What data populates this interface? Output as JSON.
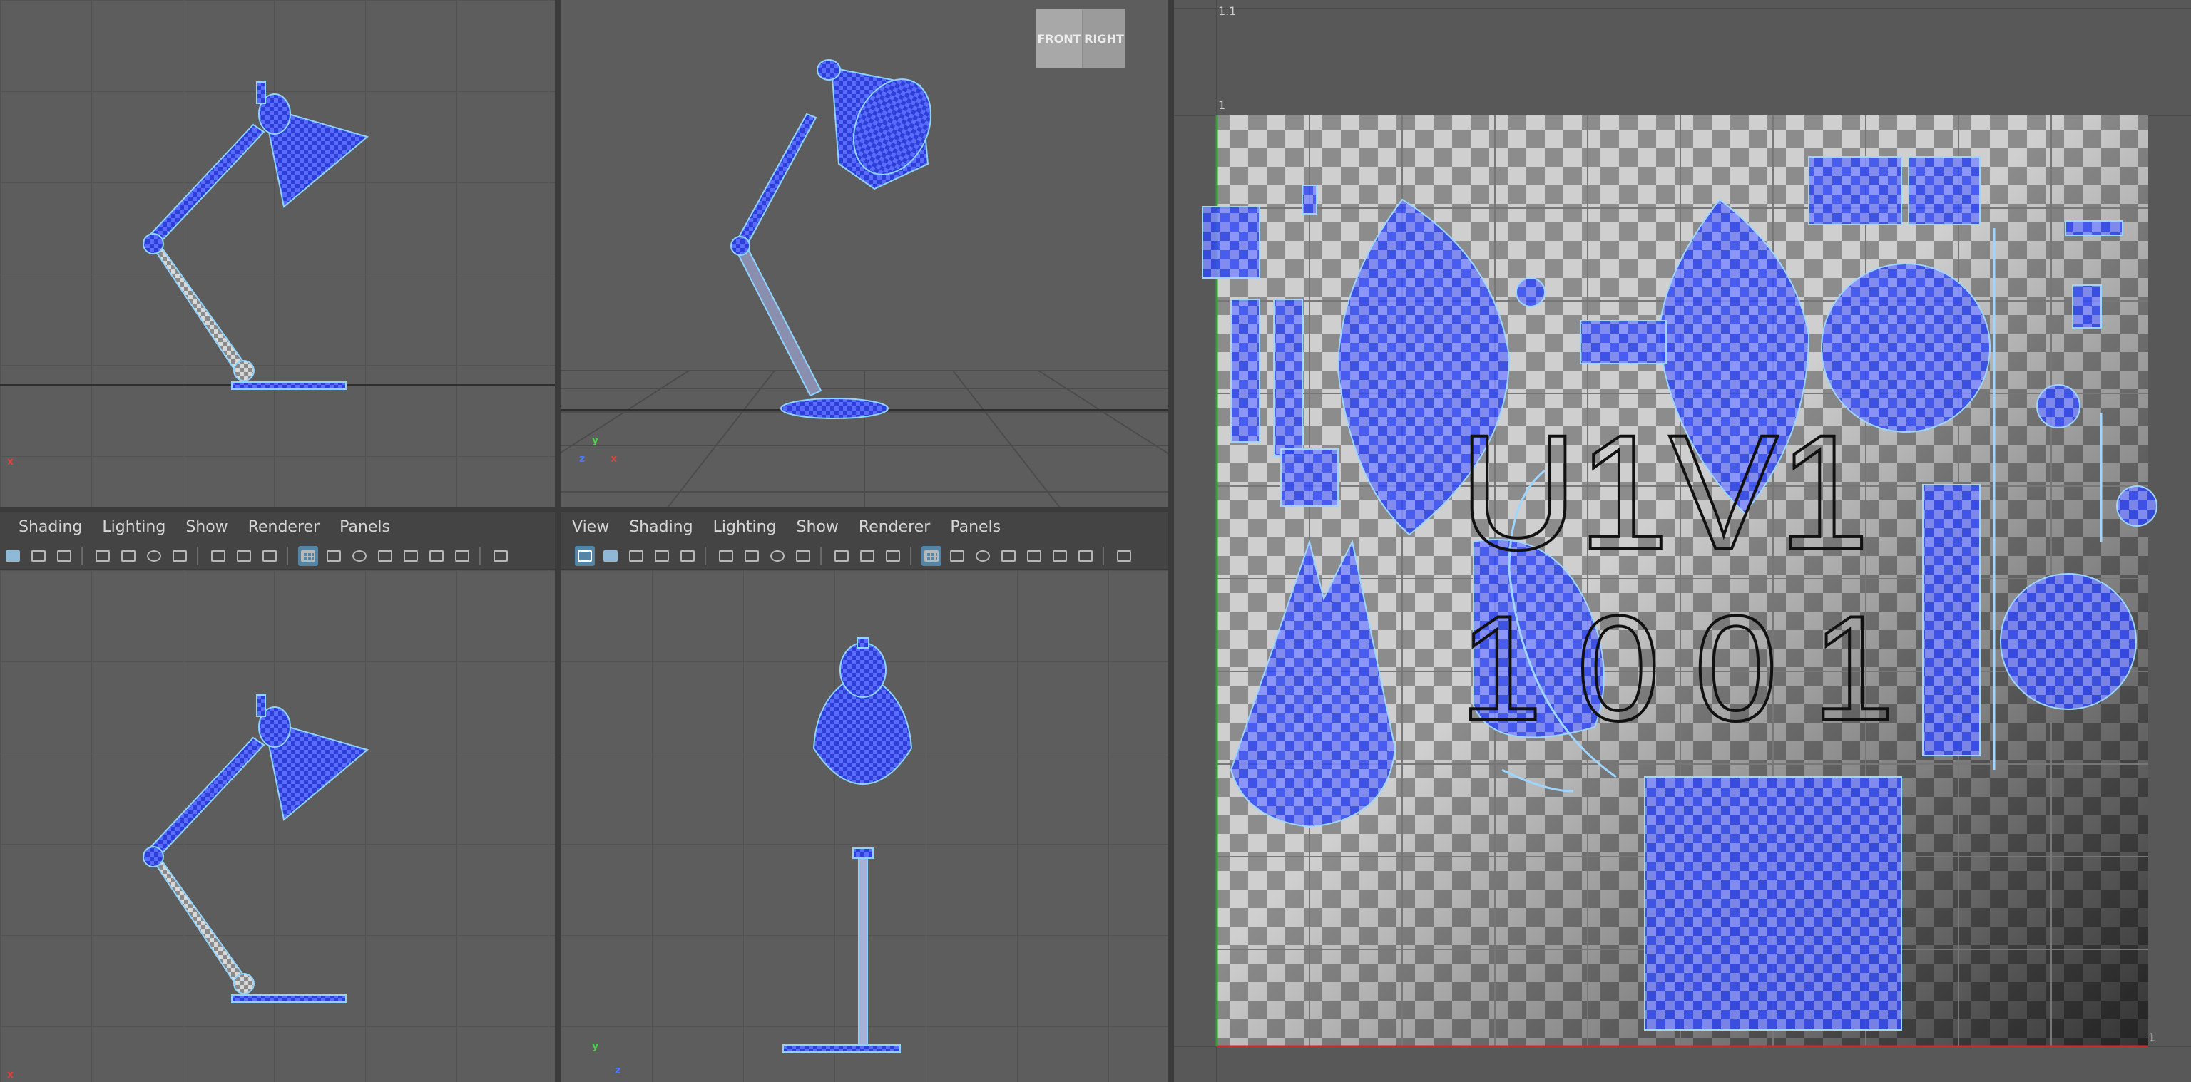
{
  "toolbar_left": {
    "menus": [
      "Shading",
      "Lighting",
      "Show",
      "Renderer",
      "Panels"
    ]
  },
  "toolbar_right": {
    "menus": [
      "View",
      "Shading",
      "Lighting",
      "Show",
      "Renderer",
      "Panels"
    ]
  },
  "view_cube": {
    "front": "FRONT",
    "right": "RIGHT"
  },
  "uv_editor": {
    "tile_label_u": "U1V1",
    "tile_label_udim": "1001",
    "ruler_top": "1.1",
    "ruler_v1": "1",
    "ruler_right": "1"
  },
  "axes": {
    "x": "x",
    "y": "y",
    "z": "z"
  },
  "colors": {
    "viewport_bg": "#5d5d5d",
    "uv_shell": "#2b4bff",
    "wire": "#8fd3ff",
    "toolbar_bg": "#444444",
    "active_tool": "#5285a6"
  },
  "icons": [
    "grid-icon",
    "camera-icon",
    "wireframe-icon",
    "smooth-shade-icon",
    "texture-icon",
    "light-icon",
    "isolate-icon",
    "xray-icon",
    "film-gate-icon",
    "resolution-gate-icon",
    "cube-icon"
  ]
}
